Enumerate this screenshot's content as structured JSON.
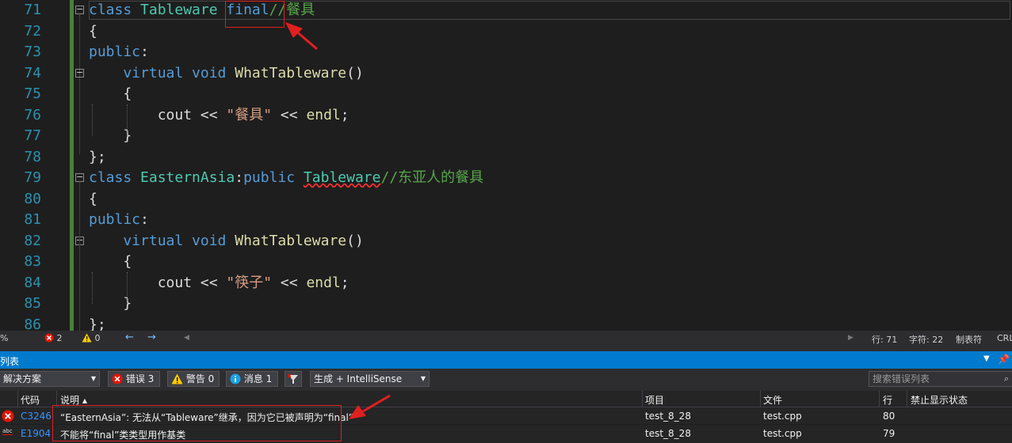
{
  "editor": {
    "lines": [
      {
        "num": "71",
        "tokens": [
          {
            "t": "class ",
            "c": "kw"
          },
          {
            "t": "Tableware ",
            "c": "ty"
          },
          {
            "t": "final",
            "c": "kw"
          },
          {
            "t": "//餐具",
            "c": "cm"
          }
        ]
      },
      {
        "num": "72",
        "tokens": [
          {
            "t": "{",
            "c": ""
          }
        ]
      },
      {
        "num": "73",
        "tokens": [
          {
            "t": "public",
            "c": "kw"
          },
          {
            "t": ":",
            "c": ""
          }
        ]
      },
      {
        "num": "74",
        "tokens": [
          {
            "t": "    virtual ",
            "c": "kw"
          },
          {
            "t": "void ",
            "c": "kw"
          },
          {
            "t": "WhatTableware",
            "c": "fn"
          },
          {
            "t": "()",
            "c": ""
          }
        ]
      },
      {
        "num": "75",
        "tokens": [
          {
            "t": "    {",
            "c": ""
          }
        ]
      },
      {
        "num": "76",
        "tokens": [
          {
            "t": "        cout << ",
            "c": ""
          },
          {
            "t": "\"餐具\"",
            "c": "str"
          },
          {
            "t": " << ",
            "c": ""
          },
          {
            "t": "endl",
            "c": "fn"
          },
          {
            "t": ";",
            "c": ""
          }
        ]
      },
      {
        "num": "77",
        "tokens": [
          {
            "t": "    }",
            "c": ""
          }
        ]
      },
      {
        "num": "78",
        "tokens": [
          {
            "t": "};",
            "c": ""
          }
        ]
      },
      {
        "num": "79",
        "tokens": [
          {
            "t": "class ",
            "c": "kw"
          },
          {
            "t": "EasternAsia",
            "c": "ty"
          },
          {
            "t": ":",
            "c": ""
          },
          {
            "t": "public ",
            "c": "kw"
          },
          {
            "t": "Tableware",
            "c": "ty squig"
          },
          {
            "t": "//东亚人的餐具",
            "c": "cm"
          }
        ]
      },
      {
        "num": "80",
        "tokens": [
          {
            "t": "{",
            "c": ""
          }
        ]
      },
      {
        "num": "81",
        "tokens": [
          {
            "t": "public",
            "c": "kw"
          },
          {
            "t": ":",
            "c": ""
          }
        ]
      },
      {
        "num": "82",
        "tokens": [
          {
            "t": "    virtual ",
            "c": "kw"
          },
          {
            "t": "void ",
            "c": "kw"
          },
          {
            "t": "WhatTableware",
            "c": "fn"
          },
          {
            "t": "()",
            "c": ""
          }
        ]
      },
      {
        "num": "83",
        "tokens": [
          {
            "t": "    {",
            "c": ""
          }
        ]
      },
      {
        "num": "84",
        "tokens": [
          {
            "t": "        cout << ",
            "c": ""
          },
          {
            "t": "\"筷子\"",
            "c": "str"
          },
          {
            "t": " << ",
            "c": ""
          },
          {
            "t": "endl",
            "c": "fn"
          },
          {
            "t": ";",
            "c": ""
          }
        ]
      },
      {
        "num": "85",
        "tokens": [
          {
            "t": "    }",
            "c": ""
          }
        ]
      },
      {
        "num": "86",
        "tokens": [
          {
            "t": "};",
            "c": ""
          }
        ]
      }
    ]
  },
  "status_bar": {
    "zoom_fragment": "%",
    "error_count": "2",
    "warning_count": "0",
    "line": "行: 71",
    "char": "字符: 22",
    "tab_mode": "制表符",
    "line_ending": "CRLF"
  },
  "error_list": {
    "title": "列表",
    "scope": "解决方案",
    "errors_label": "错误 3",
    "warnings_label": "警告 0",
    "messages_label": "消息 1",
    "build_filter": "生成 + IntelliSense",
    "search_placeholder": "搜索错误列表",
    "columns": {
      "code": "代码",
      "desc": "说明",
      "project": "项目",
      "file": "文件",
      "line": "行",
      "suppress": "禁止显示状态"
    },
    "rows": [
      {
        "code": "C3246",
        "desc": "“EasternAsia”: 无法从“Tableware”继承，因为它已被声明为“final”",
        "project": "test_8_28",
        "file": "test.cpp",
        "line": "80"
      },
      {
        "code": "E1904",
        "desc": "不能将“final”类类型用作基类",
        "project": "test_8_28",
        "file": "test.cpp",
        "line": "79"
      }
    ]
  },
  "colors": {
    "accent": "#007acc",
    "annotation": "#e02020",
    "error": "#e51400",
    "warning": "#ffcc00"
  }
}
